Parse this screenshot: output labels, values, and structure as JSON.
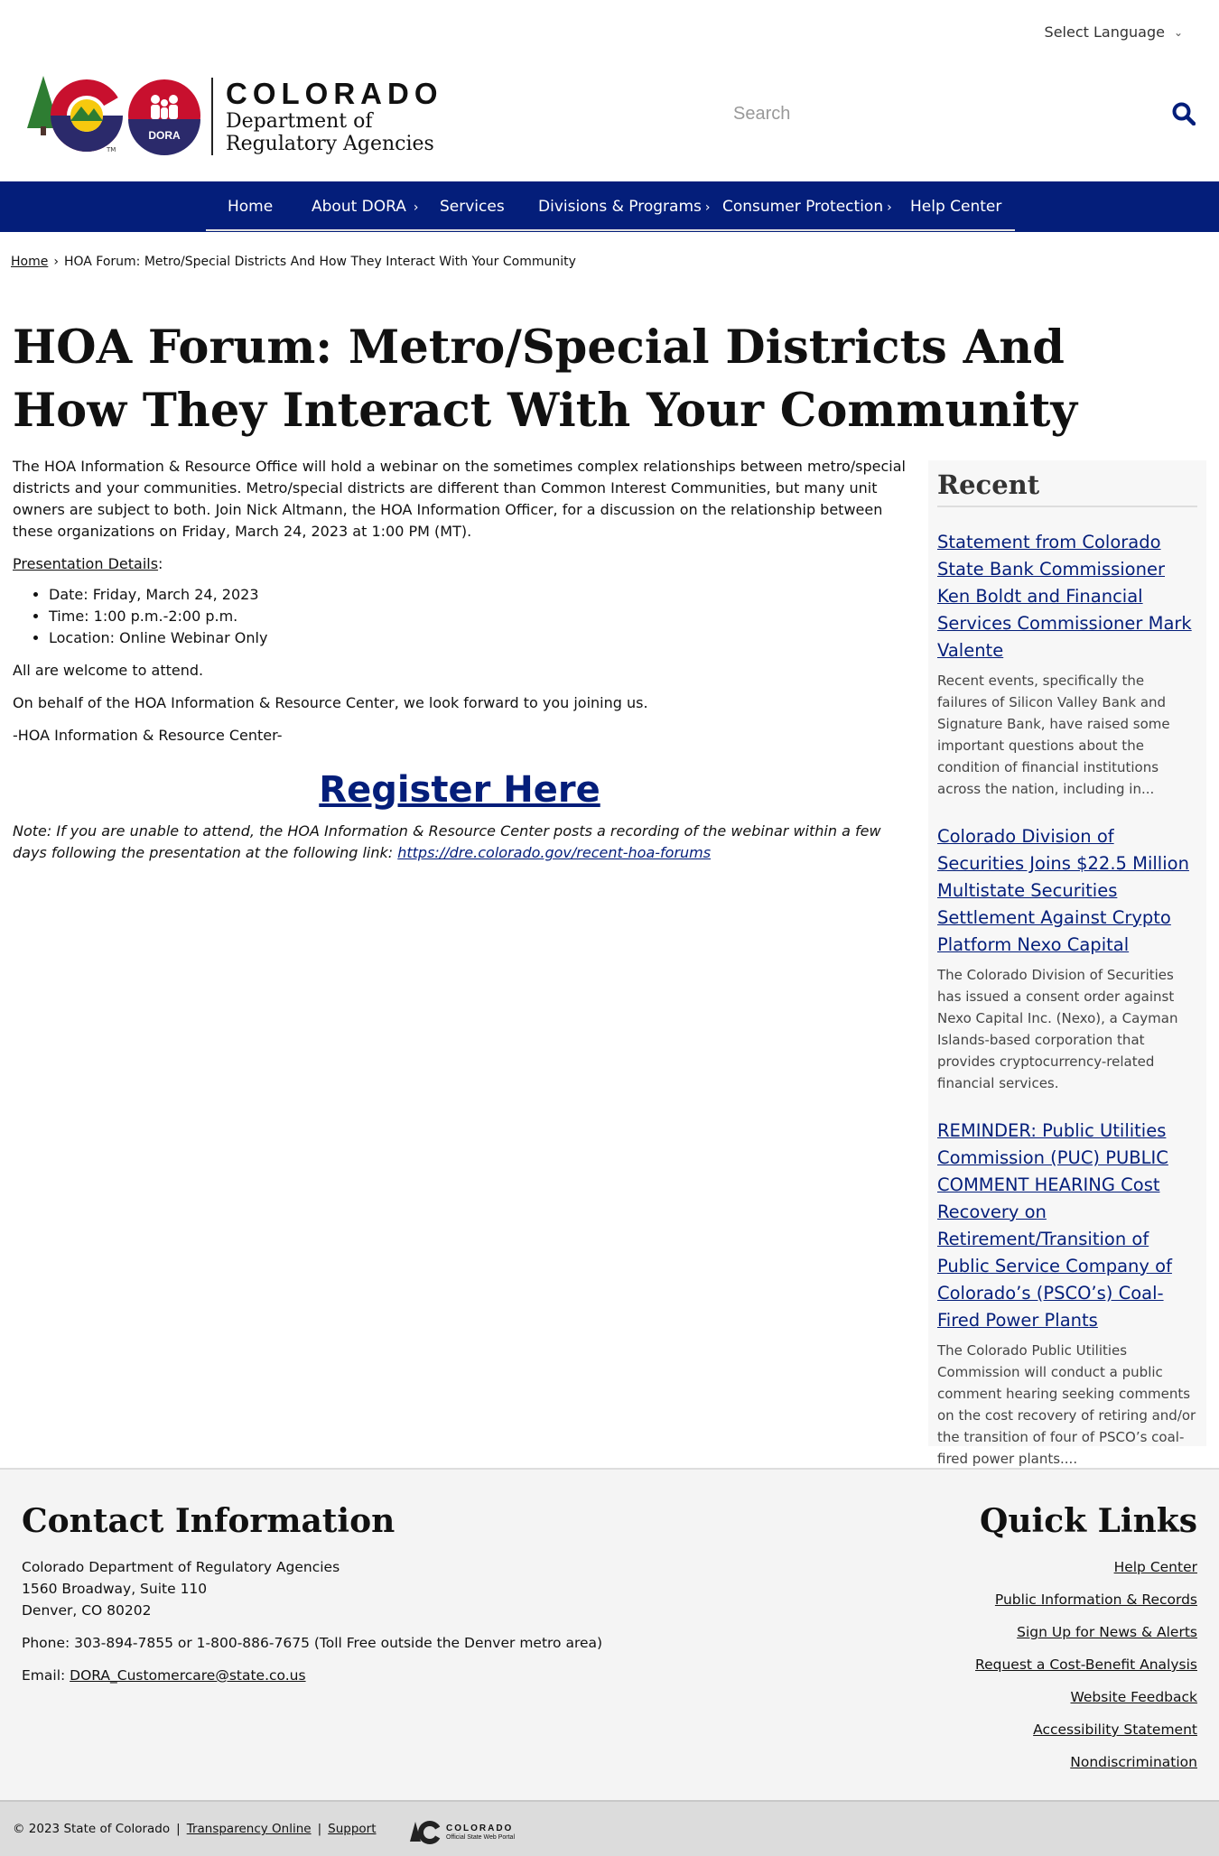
{
  "header": {
    "language_label": "Select Language",
    "logo_state": "COLORADO",
    "logo_dept_line1": "Department of",
    "logo_dept_line2": "Regulatory Agencies",
    "logo_badge": "DORA",
    "search_placeholder": "Search"
  },
  "nav": {
    "items": [
      {
        "label": "Home",
        "has_submenu": false
      },
      {
        "label": "About DORA",
        "has_submenu": true
      },
      {
        "label": "Services",
        "has_submenu": false
      },
      {
        "label": "Divisions & Programs",
        "has_submenu": true
      },
      {
        "label": "Consumer Protection",
        "has_submenu": true
      },
      {
        "label": "Help Center",
        "has_submenu": false
      }
    ],
    "color": "#041e7a"
  },
  "breadcrumb": {
    "home": "Home",
    "separator": "›",
    "current": "HOA Forum: Metro/Special Districts And How They Interact With Your Community"
  },
  "page": {
    "title": "HOA Forum: Metro/Special Districts And How They Interact With Your Community",
    "intro": "The HOA Information & Resource Office will hold a webinar on the sometimes complex relationships between metro/special districts and your communities. Metro/special districts are different than Common Interest Communities, but many unit owners are subject to both. Join Nick Altmann, the HOA Information Officer, for a discussion on the relationship between these organizations on Friday, March 24, 2023 at 1:00 PM (MT).",
    "details_heading": "Presentation Details",
    "details_colon": ":",
    "details": [
      "Date: Friday, March 24, 2023",
      "Time: 1:00 p.m.-2:00 p.m.",
      "Location: Online Webinar Only"
    ],
    "welcome": "All are welcome to attend.",
    "behalf": "On behalf of the HOA Information & Resource Center, we look forward to you joining us.",
    "signoff": "-HOA Information & Resource Center-",
    "register_label": "Register Here",
    "note_text": "Note: If you are unable to attend, the HOA Information & Resource Center posts a recording of the webinar within a few days following the presentation at the following link: ",
    "note_link": "https://dre.colorado.gov/recent-hoa-forums"
  },
  "sidebar": {
    "heading": "Recent",
    "items": [
      {
        "title": "Statement from Colorado State Bank Commissioner Ken Boldt and Financial Services Commissioner Mark Valente",
        "desc": "Recent events, specifically the failures of Silicon Valley Bank and Signature Bank, have raised some important questions about the condition of financial institutions across the nation, including in..."
      },
      {
        "title": "Colorado Division of Securities Joins $22.5 Million Multistate Securities Settlement Against Crypto Platform Nexo Capital",
        "desc": "The Colorado Division of Securities has issued a consent order against Nexo Capital Inc. (Nexo), a Cayman Islands-based corporation that provides cryptocurrency-related financial services."
      },
      {
        "title": "REMINDER: Public Utilities Commission (PUC) PUBLIC COMMENT HEARING Cost Recovery on Retirement/Transition of Public Service Company of Colorado’s (PSCO’s) Coal-Fired Power Plants",
        "desc": "The Colorado Public Utilities Commission will conduct a public comment hearing seeking comments on the cost recovery of retiring and/or the transition of four of PSCO’s coal-fired power plants...."
      }
    ]
  },
  "footer": {
    "contact_heading": "Contact Information",
    "address_line1": "Colorado Department of Regulatory Agencies",
    "address_line2": "1560 Broadway, Suite 110",
    "address_line3": "Denver, CO 80202",
    "phone": "Phone: 303-894-7855 or 1-800-886-7675 (Toll Free outside the Denver metro area)",
    "email_label": "Email: ",
    "email": "DORA_Customercare@state.co.us",
    "quick_heading": "Quick Links",
    "quick_links": [
      "Help Center",
      "Public Information & Records",
      "Sign Up for News & Alerts",
      "Request a Cost-Benefit Analysis",
      "Website Feedback",
      "Accessibility Statement",
      "Nondiscrimination"
    ],
    "copyright": "© 2023 State of Colorado",
    "separator": "|",
    "transparency": "Transparency Online",
    "support": "Support",
    "portal_name": "COLORADO",
    "portal_sub": "Official State Web Portal"
  }
}
